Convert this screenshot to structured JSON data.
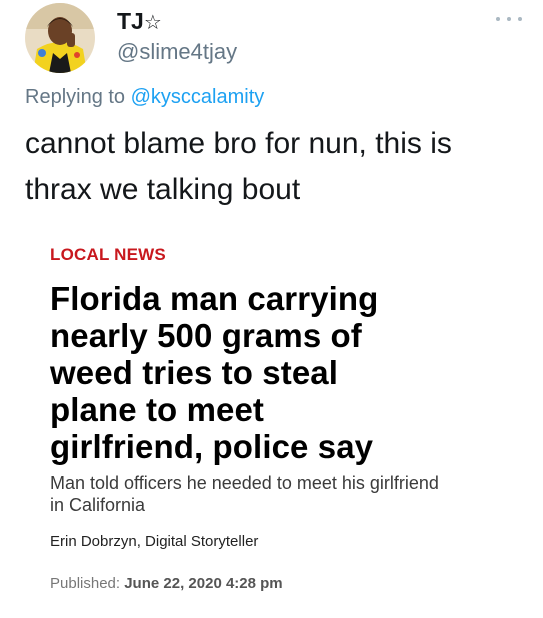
{
  "tweet": {
    "avatar_icon": "user-avatar-photo",
    "display_name": "TJ",
    "display_name_emoji": "☆",
    "handle": "@slime4tjay",
    "more_icon": "ellipsis-icon",
    "reply_prefix": "Replying to ",
    "reply_to": "@kysccalamity",
    "text_lines": [
      "cannot blame bro for nun, this is",
      "thrax we talking bout"
    ]
  },
  "article": {
    "section": "LOCAL NEWS",
    "headline_lines": [
      "Florida man carrying",
      "nearly 500 grams of",
      "weed tries to steal",
      "plane to meet",
      "girlfriend, police say"
    ],
    "dek_lines": [
      "Man told officers he needed to meet his girlfriend",
      "in California"
    ],
    "byline": "Erin Dobrzyn, Digital Storyteller",
    "published_label": "Published: ",
    "published_date": "June 22, 2020 4:28 pm"
  },
  "colors": {
    "link_blue": "#1da1f2",
    "muted_gray": "#657786",
    "section_red": "#c8181e"
  }
}
